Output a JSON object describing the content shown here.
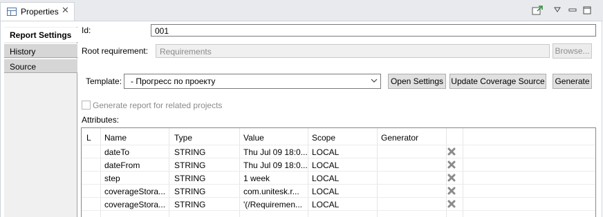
{
  "view_tab": {
    "title": "Properties"
  },
  "sidebar": {
    "items": [
      {
        "label": "Report Settings"
      },
      {
        "label": "History"
      },
      {
        "label": "Source"
      }
    ]
  },
  "form": {
    "id_label": "Id:",
    "id_value": "001",
    "root_label": "Root requirement:",
    "root_value": "Requirements",
    "browse_label": "Browse...",
    "template_label": "Template:",
    "template_value": "- Прогресс по проекту",
    "open_settings_label": "Open Settings",
    "update_coverage_label": "Update Coverage Source",
    "generate_label": "Generate",
    "related_label": "Generate report for related projects",
    "attributes_label": "Attributes:"
  },
  "table": {
    "headers": [
      "L",
      "Name",
      "Type",
      "Value",
      "Scope",
      "Generator"
    ],
    "rows": [
      {
        "name": "dateTo",
        "type": "STRING",
        "value": "Thu Jul 09 18:0...",
        "scope": "LOCAL"
      },
      {
        "name": "dateFrom",
        "type": "STRING",
        "value": "Thu Jul 09 18:0...",
        "scope": "LOCAL"
      },
      {
        "name": "step",
        "type": "STRING",
        "value": "1 week",
        "scope": "LOCAL"
      },
      {
        "name": "coverageStora...",
        "type": "STRING",
        "value": "com.unitesk.r...",
        "scope": "LOCAL"
      },
      {
        "name": "coverageStora...",
        "type": "STRING",
        "value": "'(/Requiremen...",
        "scope": "LOCAL"
      }
    ]
  },
  "icons": {
    "tab": "properties-view-icon",
    "close": "close-icon",
    "delete": "delete-x-icon",
    "pin": "pin-editor-icon",
    "menu": "view-menu-icon",
    "minimize": "minimize-icon",
    "maximize": "maximize-icon"
  }
}
